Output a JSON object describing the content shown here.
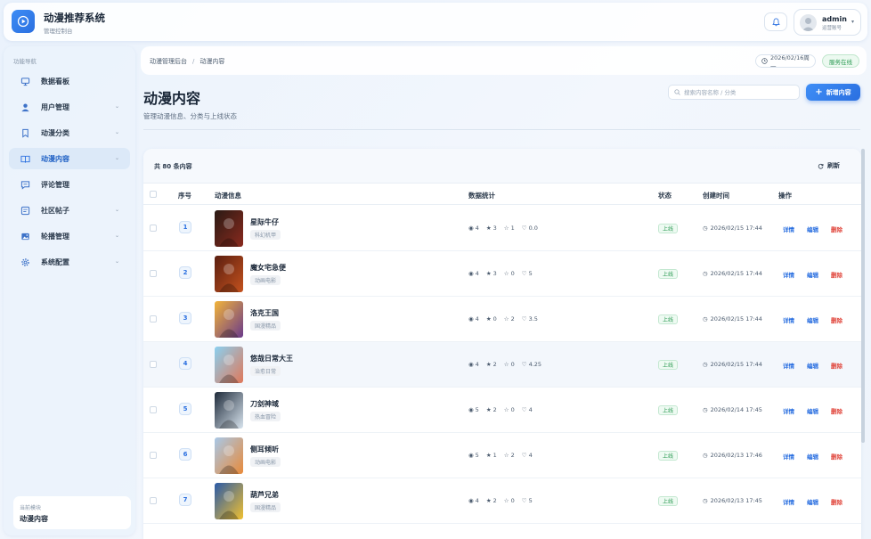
{
  "app": {
    "title": "动漫推荐系统",
    "subtitle": "管理控制台"
  },
  "user": {
    "name": "admin",
    "role": "运营账号"
  },
  "sidebar": {
    "title": "功能导航",
    "items": [
      {
        "label": "数据看板",
        "icon": "monitor-icon",
        "caret": false
      },
      {
        "label": "用户管理",
        "icon": "user-icon",
        "caret": true
      },
      {
        "label": "动漫分类",
        "icon": "bookmark-icon",
        "caret": true
      },
      {
        "label": "动漫内容",
        "icon": "book-open-icon",
        "caret": true,
        "active": true
      },
      {
        "label": "评论管理",
        "icon": "comment-icon",
        "caret": false
      },
      {
        "label": "社区帖子",
        "icon": "community-icon",
        "caret": true
      },
      {
        "label": "轮播管理",
        "icon": "image-icon",
        "caret": true
      },
      {
        "label": "系统配置",
        "icon": "gear-icon",
        "caret": true
      }
    ],
    "current_module_label": "当前模块",
    "current_module_value": "动漫内容"
  },
  "breadcrumb": {
    "root": "动漫管理后台",
    "current": "动漫内容"
  },
  "date_pill": "2026/02/16周一",
  "service_status": "服务在线",
  "page": {
    "title": "动漫内容",
    "subtitle": "管理动漫信息、分类与上线状态",
    "search_placeholder": "搜索内容名称 / 分类",
    "add_button": "新增内容"
  },
  "table": {
    "total_text": "共 80 条内容",
    "refresh_label": "刷新",
    "headers": {
      "index": "序号",
      "info": "动漫信息",
      "stats": "数据统计",
      "status": "状态",
      "created": "创建时间",
      "actions": "操作"
    },
    "action_labels": {
      "detail": "详情",
      "edit": "编辑",
      "delete": "删除"
    },
    "rows": [
      {
        "index": "1",
        "name": "星际牛仔",
        "category": "科幻机甲",
        "views": "4",
        "favs": "3",
        "rates": "1",
        "score": "0.0",
        "status": "上线",
        "created": "2026/02/15 17:44",
        "poster_colors": [
          "#2a1a14",
          "#8a2a1e"
        ]
      },
      {
        "index": "2",
        "name": "魔女宅急便",
        "category": "动画电影",
        "views": "4",
        "favs": "3",
        "rates": "0",
        "score": "5",
        "status": "上线",
        "created": "2026/02/15 17:44",
        "poster_colors": [
          "#5a1e10",
          "#c4521e"
        ]
      },
      {
        "index": "3",
        "name": "洛克王国",
        "category": "国漫精品",
        "views": "4",
        "favs": "0",
        "rates": "2",
        "score": "3.5",
        "status": "上线",
        "created": "2026/02/15 17:44",
        "poster_colors": [
          "#f2b43a",
          "#6a3a8a"
        ]
      },
      {
        "index": "4",
        "name": "悠哉日常大王",
        "category": "治愈日常",
        "views": "4",
        "favs": "2",
        "rates": "0",
        "score": "4.25",
        "status": "上线",
        "created": "2026/02/15 17:44",
        "poster_colors": [
          "#8ad0f0",
          "#e0785a"
        ]
      },
      {
        "index": "5",
        "name": "刀剑神域",
        "category": "热血冒险",
        "views": "5",
        "favs": "2",
        "rates": "0",
        "score": "4",
        "status": "上线",
        "created": "2026/02/14 17:45",
        "poster_colors": [
          "#1e2a3a",
          "#d8e4ee"
        ]
      },
      {
        "index": "6",
        "name": "侧耳倾听",
        "category": "动画电影",
        "views": "5",
        "favs": "1",
        "rates": "2",
        "score": "4",
        "status": "上线",
        "created": "2026/02/13 17:46",
        "poster_colors": [
          "#a8c8e8",
          "#e88a3a"
        ]
      },
      {
        "index": "7",
        "name": "葫芦兄弟",
        "category": "国漫精品",
        "views": "4",
        "favs": "2",
        "rates": "0",
        "score": "5",
        "status": "上线",
        "created": "2026/02/13 17:45",
        "poster_colors": [
          "#2a5aa8",
          "#f0c030"
        ]
      }
    ]
  }
}
